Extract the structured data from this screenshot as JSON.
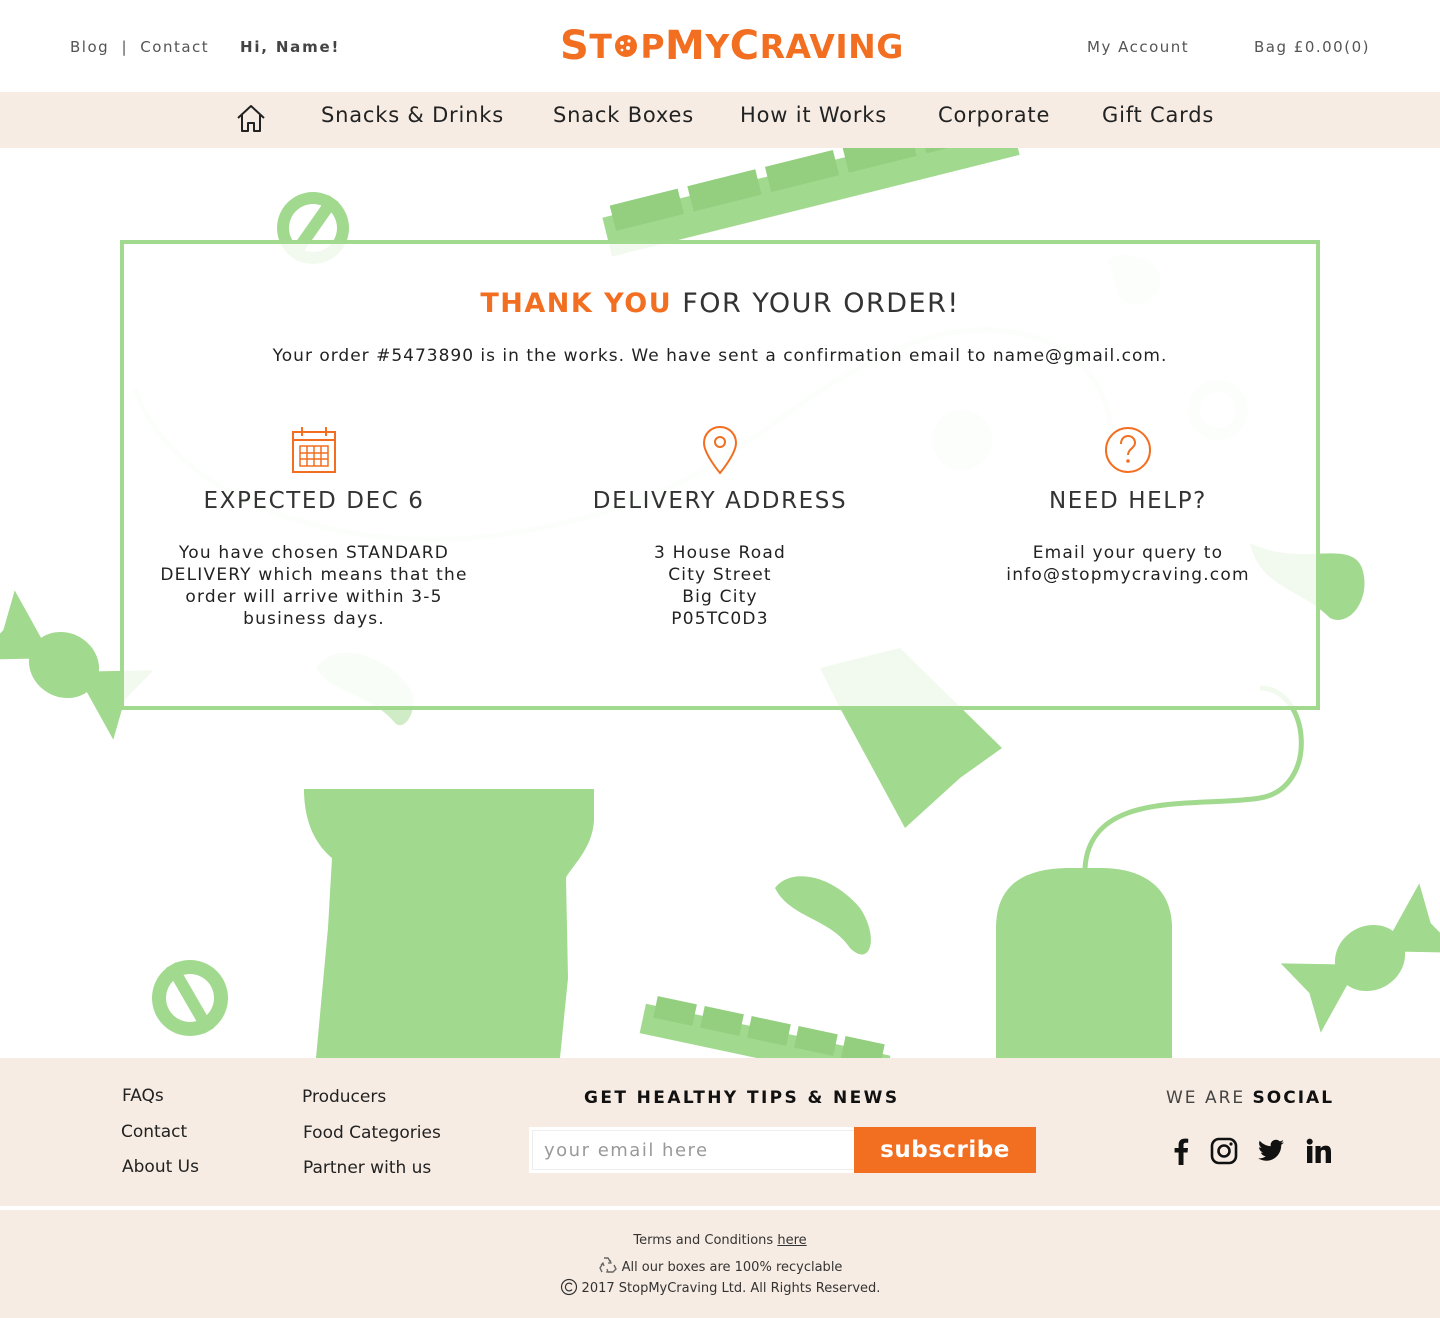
{
  "header": {
    "blog_label": "Blog",
    "separator": "|",
    "contact_label": "Contact",
    "greeting": "Hi, Name!",
    "logo_part1": "S",
    "logo_part2": "T",
    "logo_part3": "P",
    "logo_part4": "M",
    "logo_part5": "Y",
    "logo_part6": "C",
    "logo_part7": "RAVING",
    "logo_text": "StopMyCraving",
    "account_label": "My Account",
    "bag_label": "Bag £0.00(0)"
  },
  "nav": {
    "home_icon": "home-icon",
    "items": [
      {
        "label": "Snacks & Drinks"
      },
      {
        "label": "Snack Boxes"
      },
      {
        "label": "How it Works"
      },
      {
        "label": "Corporate"
      },
      {
        "label": "Gift Cards"
      }
    ]
  },
  "order": {
    "title_accent": "THANK YOU",
    "title_rest": " FOR YOUR ORDER!",
    "message": "Your order #5473890 is in the works. We have sent a confirmation email to name@gmail.com.",
    "columns": [
      {
        "icon": "calendar-icon",
        "heading": "EXPECTED DEC 6",
        "lines": [
          "You have chosen STANDARD",
          "DELIVERY which means that the",
          "order will arrive within 3-5",
          "business days."
        ]
      },
      {
        "icon": "location-pin-icon",
        "heading": "DELIVERY ADDRESS",
        "lines": [
          "3 House Road",
          "City Street",
          "Big City",
          "P05TC0D3"
        ]
      },
      {
        "icon": "help-question-icon",
        "heading": "NEED HELP?",
        "lines": [
          "Email your query to",
          "info@stopmycraving.com"
        ]
      }
    ]
  },
  "footer": {
    "links_col1": [
      "FAQs",
      "Contact",
      "About Us"
    ],
    "links_col2": [
      "Producers",
      "Food Categories",
      "Partner with us"
    ],
    "newsletter_title": "GET HEALTHY TIPS & NEWS",
    "email_placeholder": "your email here",
    "subscribe_label": "subscribe",
    "social_prefix": "WE ARE ",
    "social_bold": "SOCIAL",
    "social_icons": [
      "facebook-icon",
      "instagram-icon",
      "twitter-icon",
      "linkedin-icon"
    ],
    "terms_text": "Terms and Conditions ",
    "terms_link": "here",
    "recycle_text": "All our boxes are 100% recyclable",
    "copyright_text": "2017 StopMyCraving Ltd. All Rights Reserved."
  },
  "colors": {
    "accent": "#f26f21",
    "green": "#a1d98e",
    "cream": "#f7ece3"
  }
}
